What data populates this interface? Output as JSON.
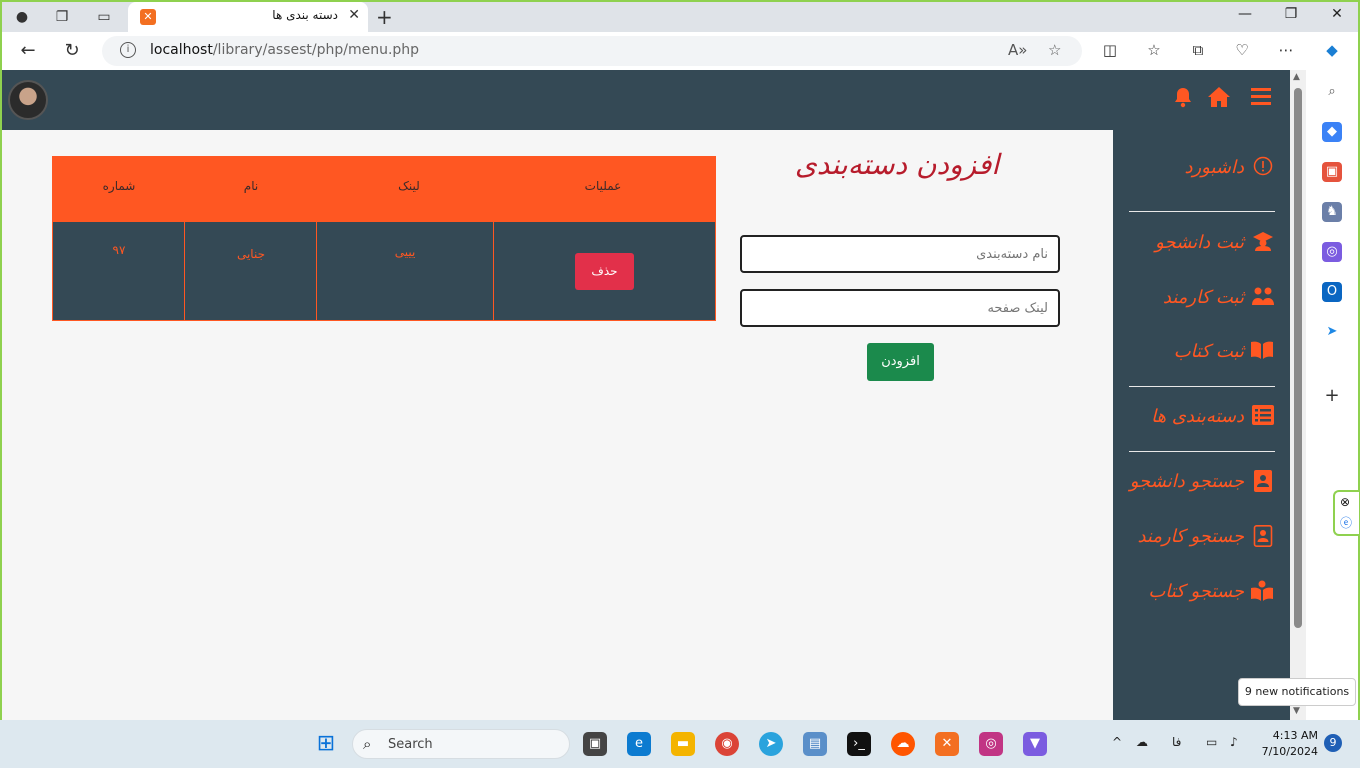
{
  "browser": {
    "tab_title": "دسته بندی ها",
    "url_host": "localhost",
    "url_path": "/library/assest/php/menu.php",
    "tab_close": "✕",
    "new_tab": "+"
  },
  "page": {
    "form_title": "افزودن دسته‌بندی",
    "inputs": {
      "category_name_placeholder": "نام دسته‌بندی",
      "page_link_placeholder": "لینک صفحه"
    },
    "add_button": "افزودن",
    "sidebar": [
      {
        "label": "داشبورد",
        "icon": "dashboard-icon"
      },
      {
        "label": "ثبت دانشجو",
        "icon": "graduate-icon"
      },
      {
        "label": "ثبت کارمند",
        "icon": "users-icon"
      },
      {
        "label": "ثبت کتاب",
        "icon": "book-icon"
      },
      {
        "label": "دسته‌بندی ها",
        "icon": "list-icon"
      },
      {
        "label": "جستجو دانشجو",
        "icon": "contact-book-icon"
      },
      {
        "label": "جستجو کارمند",
        "icon": "address-book-icon"
      },
      {
        "label": "جستجو کتاب",
        "icon": "book-reader-icon"
      }
    ],
    "table": {
      "headers": {
        "ops": "عملیات",
        "link": "لینک",
        "name": "نام",
        "num": "شماره"
      },
      "rows": [
        {
          "ops": "حذف",
          "link": "یییی",
          "name": "جنایی",
          "num": "۹۷"
        }
      ]
    }
  },
  "overlay": {
    "toast": "9 new notifications"
  },
  "taskbar": {
    "search_placeholder": "Search",
    "lang": "فا",
    "time": "4:13 AM",
    "date": "7/10/2024",
    "notif_count": "9"
  },
  "colors": {
    "accent": "#ff5722",
    "nav_bg": "#344955",
    "add_btn": "#1b8a4c",
    "del_btn": "#e2304a",
    "title": "#b71c2c"
  }
}
